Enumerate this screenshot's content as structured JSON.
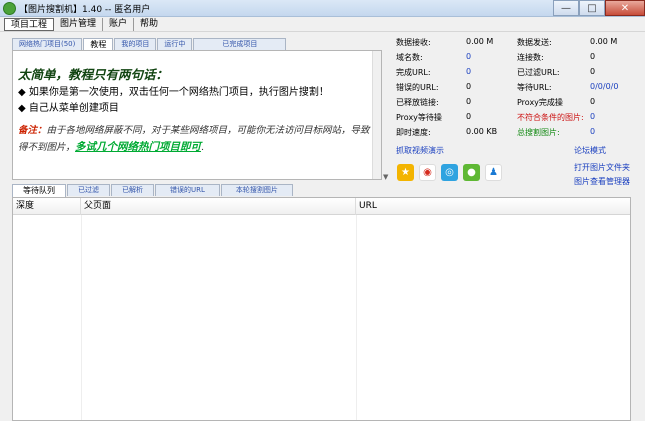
{
  "window": {
    "title": "【图片搜割机】1.40 -- 匿名用户",
    "min_glyph": "—",
    "max_glyph": "□",
    "close_glyph": "✕"
  },
  "menu": [
    "项目工程",
    "图片管理",
    "账户",
    "帮助"
  ],
  "top_tabs": [
    "网络热门项目(50)",
    "教程",
    "我的项目",
    "运行中",
    "已完成项目"
  ],
  "tutorial": {
    "title": "太简单，教程只有两句话：",
    "line1": "◆ 如果你是第一次使用，双击任何一个网络热门项目，执行图片搜割！",
    "line2": "◆ 自己从菜单创建项目",
    "note_label": "备注：",
    "note_text": "由于各地网络屏蔽不同，对于某些网络项目，可能你无法访问目标网站，导致得不到图片，",
    "note_link": "多试几个网络热门项目即可",
    "note_end": "."
  },
  "stats_left": [
    {
      "label": "数据接收:",
      "value": "0.00 M"
    },
    {
      "label": "域名数:",
      "value": "0"
    },
    {
      "label": "完成URL:",
      "value": "0"
    },
    {
      "label": "错误的URL:",
      "value": "0"
    },
    {
      "label": "已释放链接:",
      "value": "0"
    },
    {
      "label": "Proxy等待操",
      "value": "0"
    },
    {
      "label": "即时速度:",
      "value": "0.00 KB"
    }
  ],
  "stats_right": [
    {
      "label": "数据发送:",
      "value": "0.00 M"
    },
    {
      "label": "连接数:",
      "value": "0"
    },
    {
      "label": "已过滤URL:",
      "value": "0"
    },
    {
      "label": "等待URL:",
      "value": "0/0/0/0"
    },
    {
      "label": "Proxy完成操",
      "value": "0"
    },
    {
      "label": "不符合条件的图片:",
      "value": "0"
    },
    {
      "label": "总搜割图片:",
      "value": "0"
    }
  ],
  "links": {
    "video_demo": "抓取视频演示",
    "forum_mode": "论坛模式",
    "open_folder": "打开图片文件夹",
    "image_manager": "图片查看管理器"
  },
  "social_icons": [
    "qzone-icon",
    "weibo-icon",
    "tencent-weibo-icon",
    "wechat-icon",
    "qq-icon"
  ],
  "bottom_tabs": [
    "等待队列",
    "已过滤",
    "已解析",
    "错误的URL",
    "本轮搜割图片"
  ],
  "table": {
    "columns": [
      "深度",
      "父页面",
      "URL"
    ],
    "rows": []
  },
  "colors": {
    "accent_blue": "#1a3fbf",
    "warning_red": "#cc1111",
    "success_green": "#118811"
  }
}
